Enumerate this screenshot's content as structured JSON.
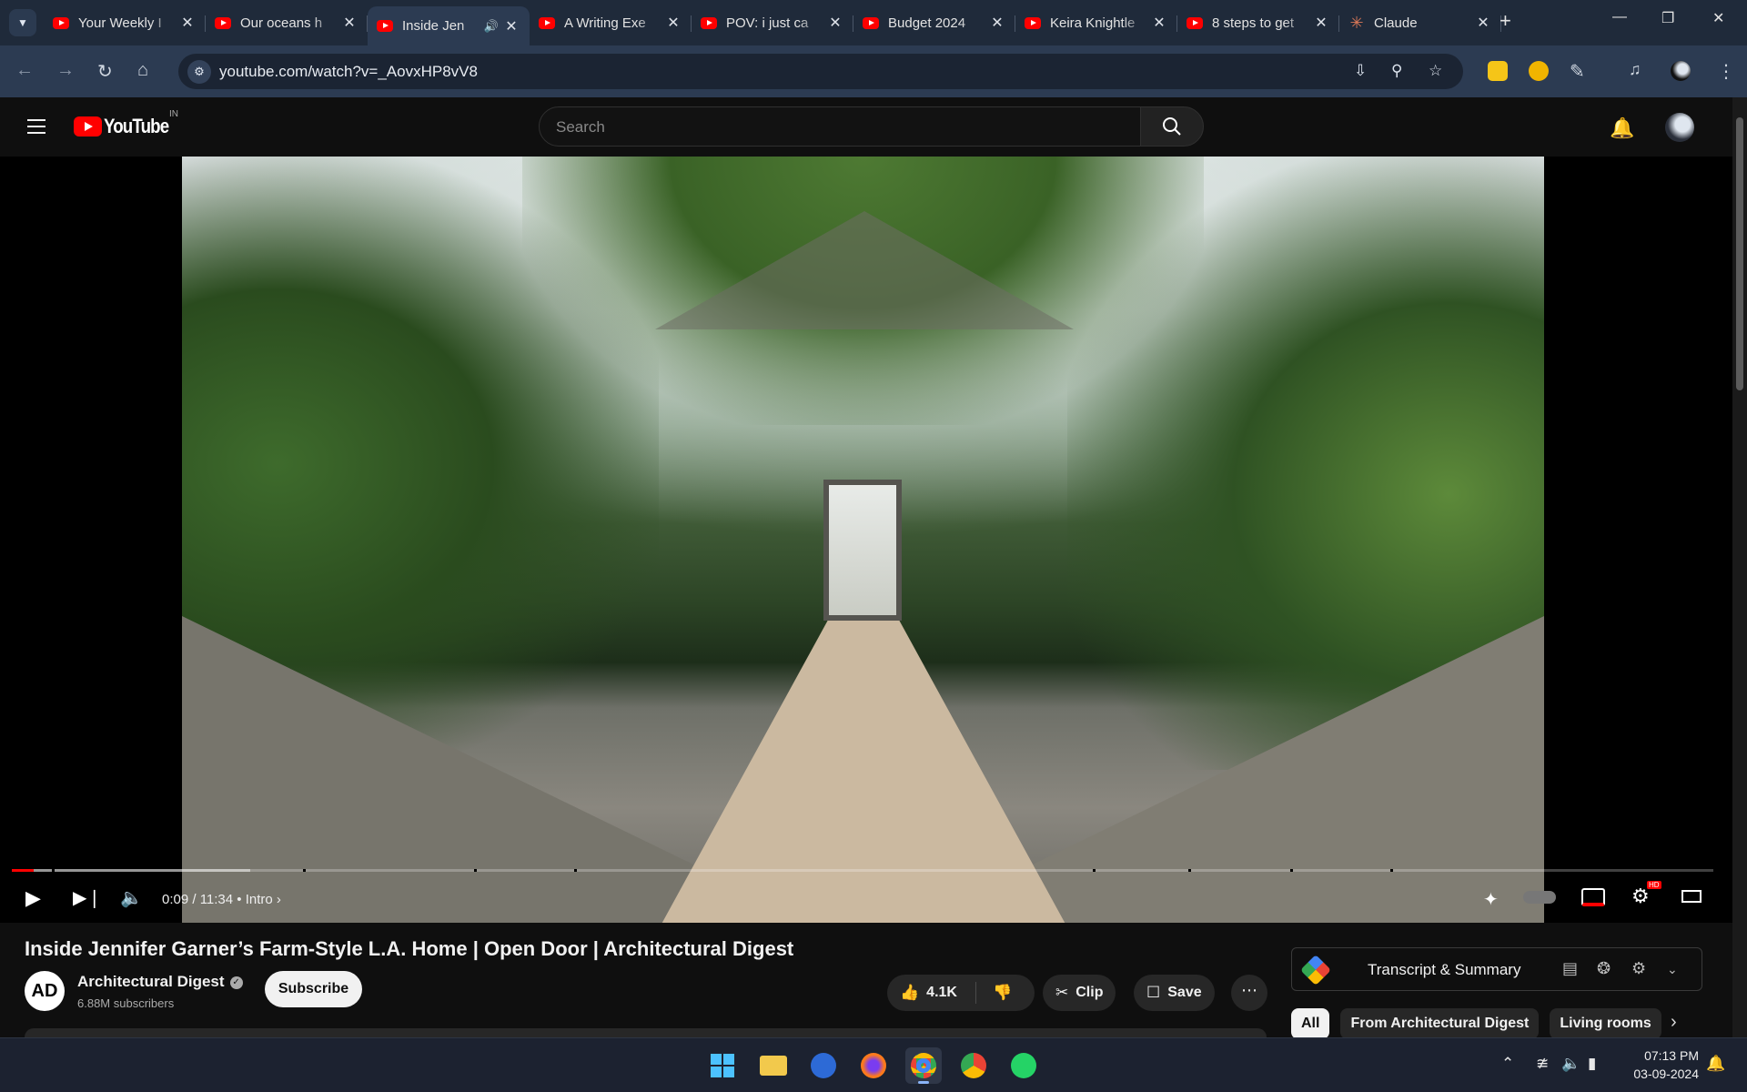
{
  "browser": {
    "tabs": [
      {
        "title": "Your Weekly I",
        "icon": "youtube-icon",
        "active": false
      },
      {
        "title": "Our oceans h",
        "icon": "youtube-icon",
        "active": false
      },
      {
        "title": "Inside Jen",
        "icon": "youtube-icon",
        "active": true,
        "audio": true
      },
      {
        "title": "A Writing Exe",
        "icon": "youtube-icon",
        "active": false
      },
      {
        "title": "POV: i just ca",
        "icon": "youtube-icon",
        "active": false
      },
      {
        "title": "Budget 2024",
        "icon": "youtube-icon",
        "active": false
      },
      {
        "title": "Keira Knightle",
        "icon": "youtube-icon",
        "active": false
      },
      {
        "title": "8 steps to get",
        "icon": "youtube-icon",
        "active": false
      },
      {
        "title": "Claude",
        "icon": "claude-icon",
        "active": false
      }
    ],
    "url": "youtube.com/watch?v=_AovxHP8vV8"
  },
  "youtube": {
    "logo_text": "YouTube",
    "country_code": "IN",
    "search_placeholder": "Search"
  },
  "player": {
    "progress_fraction": 0.013,
    "buffered_fraction": 0.14,
    "time_current": "0:09",
    "time_total": "11:34",
    "time_display": "0:09 / 11:34",
    "chapter": "Intro",
    "quality_badge": "HD"
  },
  "video": {
    "title": "Inside Jennifer Garner’s Farm-Style L.A. Home | Open Door | Architectural Digest",
    "channel_name": "Architectural Digest",
    "channel_initials": "AD",
    "subscribers": "6.88M subscribers",
    "subscribe_label": "Subscribe",
    "likes": "4.1K",
    "clip_label": "Clip",
    "save_label": "Save",
    "more_label": "⋯"
  },
  "sidebar": {
    "extension_label": "Transcript & Summary",
    "chips": [
      "All",
      "From Architectural Digest",
      "Living rooms"
    ]
  },
  "taskbar": {
    "time": "07:13 PM",
    "date": "03-09-2024"
  },
  "colors": {
    "youtube_red": "#ff0000",
    "chrome_frame": "#1f2a3a",
    "chrome_toolbar": "#2c3b52",
    "yt_background": "#0f0f0f"
  }
}
